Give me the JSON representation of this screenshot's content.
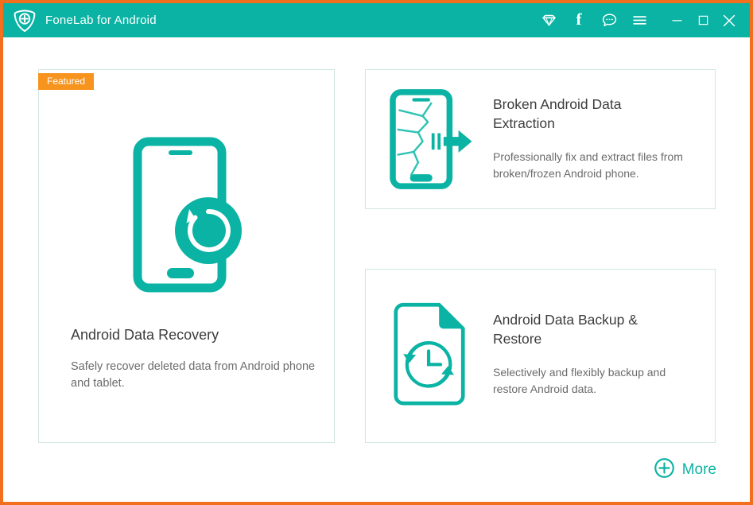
{
  "window": {
    "title": "FoneLab for Android",
    "logo_icon": "shield-plus-logo",
    "accent_teal": "#0ab3a3",
    "accent_orange": "#f2701d",
    "badge_orange": "#f7941e",
    "titlebar_icons": [
      {
        "name": "diamond-icon",
        "glyph": "diamond"
      },
      {
        "name": "facebook-icon",
        "glyph": "f"
      },
      {
        "name": "feedback-chat-icon",
        "glyph": "chat"
      },
      {
        "name": "hamburger-menu-icon",
        "glyph": "menu"
      }
    ],
    "controls": [
      {
        "name": "minimize-button",
        "glyph": "minimize"
      },
      {
        "name": "maximize-button",
        "glyph": "maximize"
      },
      {
        "name": "close-button",
        "glyph": "close"
      }
    ]
  },
  "badge": {
    "label": "Featured"
  },
  "cards": {
    "recovery": {
      "title": "Android Data Recovery",
      "desc": "Safely recover deleted data from Android phone and tablet.",
      "icon": "phone-restore-icon"
    },
    "broken": {
      "title": "Broken Android Data Extraction",
      "desc": "Professionally fix and extract files from broken/frozen Android phone.",
      "icon": "broken-phone-extract-icon"
    },
    "backup": {
      "title": "Android Data Backup & Restore",
      "desc": "Selectively and flexibly backup and restore Android data.",
      "icon": "document-clock-restore-icon"
    }
  },
  "more": {
    "label": "More",
    "icon": "plus-circle-icon"
  }
}
